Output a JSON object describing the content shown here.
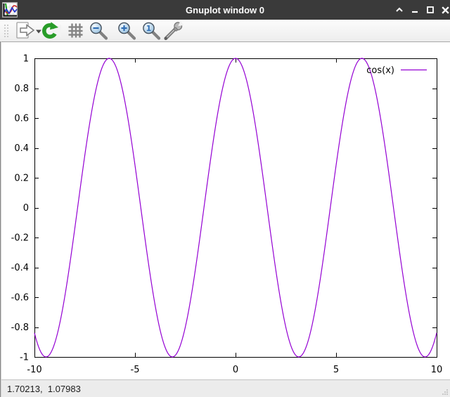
{
  "window": {
    "title": "Gnuplot window 0",
    "controls": [
      {
        "name": "shade"
      },
      {
        "name": "minimize"
      },
      {
        "name": "maximize"
      },
      {
        "name": "close"
      }
    ]
  },
  "toolbar": {
    "buttons": [
      {
        "name": "export",
        "icon": "document-export-icon",
        "has_dropdown": true
      },
      {
        "name": "replot",
        "icon": "refresh-icon"
      },
      {
        "name": "grid",
        "icon": "grid-icon"
      },
      {
        "name": "zoom-out",
        "icon": "zoom-out-icon"
      },
      {
        "name": "zoom-in",
        "icon": "zoom-in-icon"
      },
      {
        "name": "zoom-original",
        "icon": "zoom-original-icon"
      },
      {
        "name": "settings",
        "icon": "wrench-icon"
      }
    ]
  },
  "chart_data": {
    "type": "line",
    "title": "",
    "series": [
      {
        "name": "cos(x)",
        "function": "cos",
        "color": "#9400d3",
        "samples": 400
      }
    ],
    "xlim": [
      -10,
      10
    ],
    "ylim": [
      -1,
      1
    ],
    "x_ticks": [
      -10,
      -5,
      0,
      5,
      10
    ],
    "y_ticks": [
      1,
      0.8,
      0.6,
      0.4,
      0.2,
      0,
      -0.2,
      -0.4,
      -0.6,
      -0.8,
      -1
    ],
    "grid": false,
    "legend_position": "top-right",
    "border_color": "#000000"
  },
  "statusbar": {
    "coordinates": "1.70213,  1.07983"
  }
}
